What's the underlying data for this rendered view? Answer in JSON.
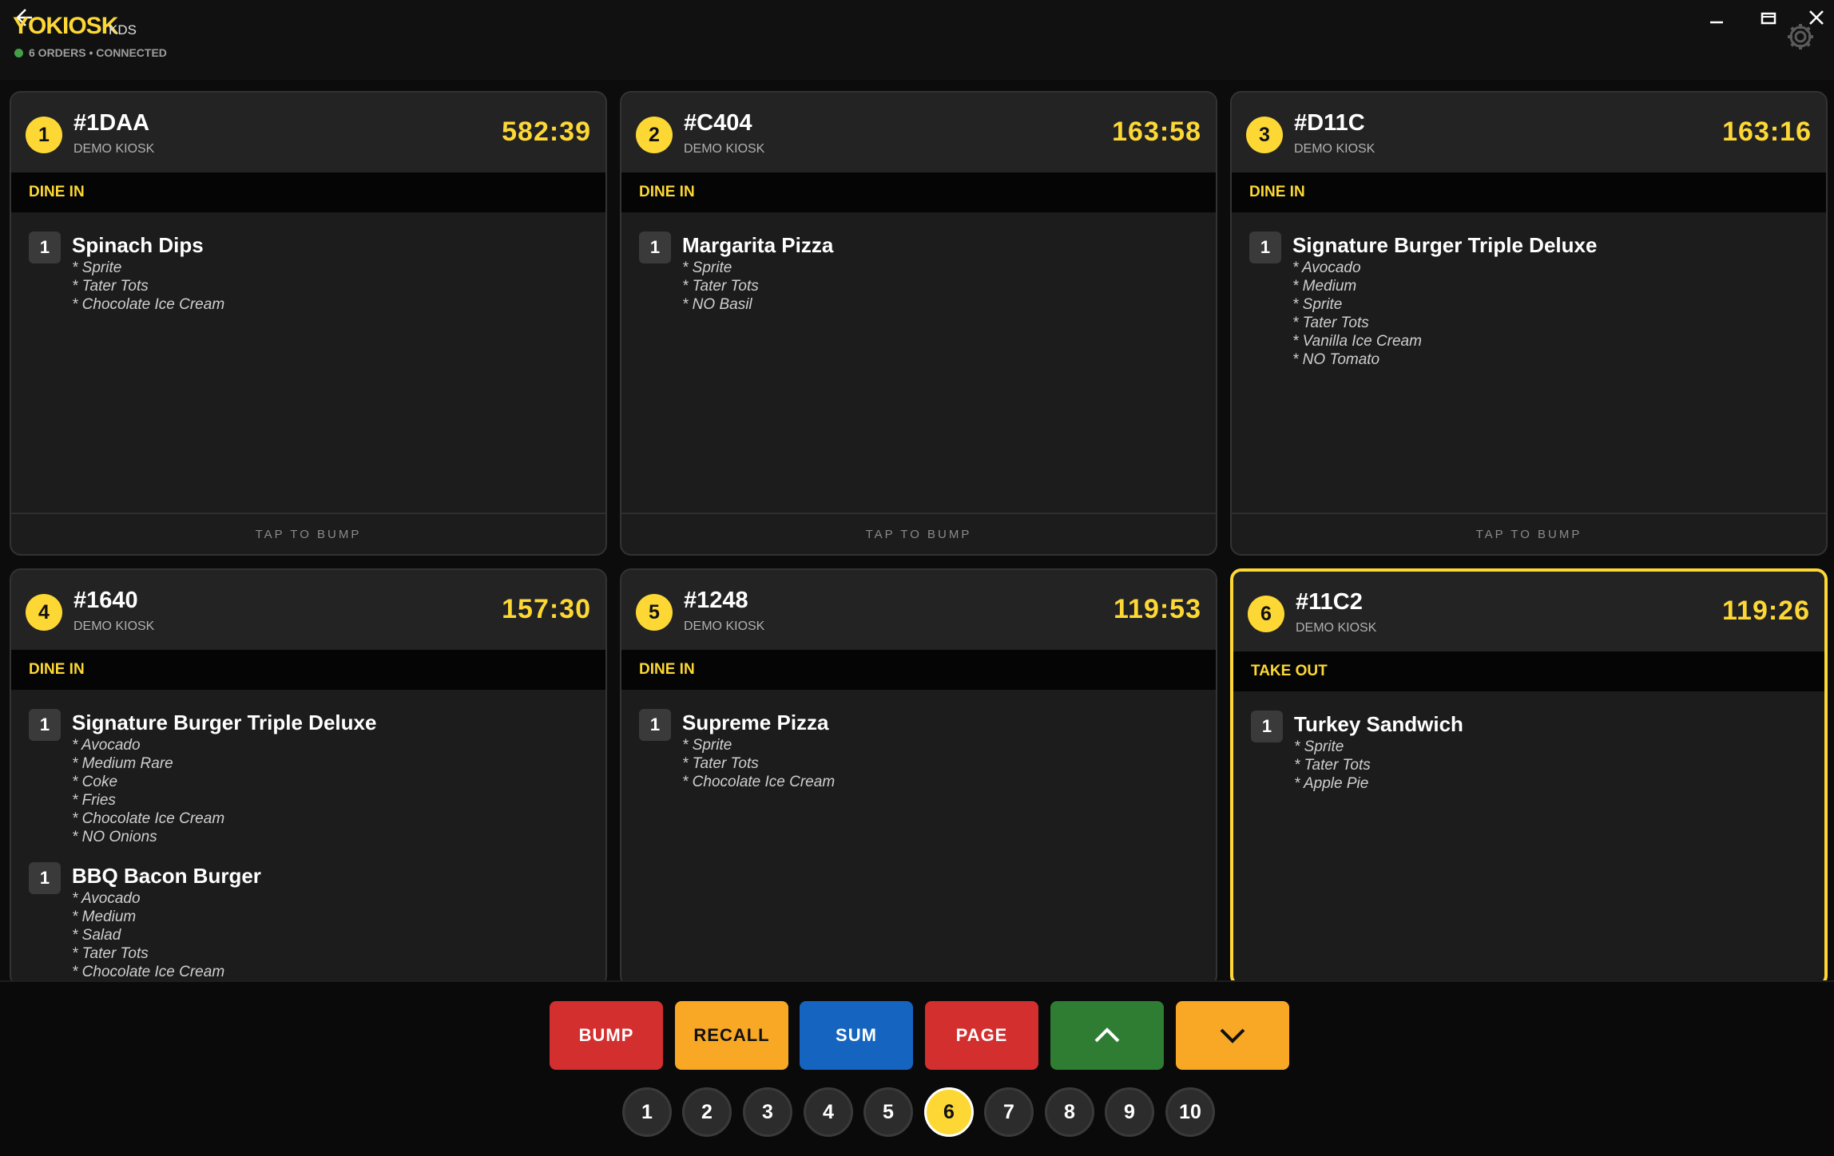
{
  "app": {
    "logo": "YOKIOSK",
    "logo_sub": "KDS",
    "status": "6 ORDERS • CONNECTED"
  },
  "icons": {
    "back": "back-arrow-icon",
    "minimize": "minimize-icon",
    "maximize": "maximize-icon",
    "close": "close-icon",
    "settings": "gear-icon"
  },
  "orders": [
    {
      "number": "1",
      "id": "#1DAA",
      "source": "DEMO KIOSK",
      "timer": "582:39",
      "type": "DINE IN",
      "footer": "TAP TO BUMP",
      "items": [
        {
          "qty": "1",
          "name": "Spinach Dips",
          "mods": [
            "* Sprite",
            "* Tater Tots",
            "* Chocolate Ice Cream"
          ]
        }
      ]
    },
    {
      "number": "2",
      "id": "#C404",
      "source": "DEMO KIOSK",
      "timer": "163:58",
      "type": "DINE IN",
      "footer": "TAP TO BUMP",
      "items": [
        {
          "qty": "1",
          "name": "Margarita Pizza",
          "mods": [
            "* Sprite",
            "* Tater Tots",
            "* NO Basil"
          ]
        }
      ]
    },
    {
      "number": "3",
      "id": "#D11C",
      "source": "DEMO KIOSK",
      "timer": "163:16",
      "type": "DINE IN",
      "footer": "TAP TO BUMP",
      "items": [
        {
          "qty": "1",
          "name": "Signature Burger Triple Deluxe",
          "mods": [
            "* Avocado",
            "* Medium",
            "* Sprite",
            "* Tater Tots",
            "* Vanilla Ice Cream",
            "* NO Tomato"
          ]
        }
      ]
    },
    {
      "number": "4",
      "id": "#1640",
      "source": "DEMO KIOSK",
      "timer": "157:30",
      "type": "DINE IN",
      "items": [
        {
          "qty": "1",
          "name": "Signature Burger Triple Deluxe",
          "mods": [
            "* Avocado",
            "* Medium Rare",
            "* Coke",
            "* Fries",
            "* Chocolate Ice Cream",
            "* NO Onions"
          ]
        },
        {
          "qty": "1",
          "name": "BBQ Bacon Burger",
          "mods": [
            "* Avocado",
            "* Medium",
            "* Salad",
            "* Tater Tots",
            "* Chocolate Ice Cream"
          ]
        }
      ]
    },
    {
      "number": "5",
      "id": "#1248",
      "source": "DEMO KIOSK",
      "timer": "119:53",
      "type": "DINE IN",
      "items": [
        {
          "qty": "1",
          "name": "Supreme Pizza",
          "mods": [
            "* Sprite",
            "* Tater Tots",
            "* Chocolate Ice Cream"
          ]
        }
      ]
    },
    {
      "number": "6",
      "id": "#11C2",
      "source": "DEMO KIOSK",
      "timer": "119:26",
      "type": "TAKE OUT",
      "selected": true,
      "items": [
        {
          "qty": "1",
          "name": "Turkey Sandwich",
          "mods": [
            "* Sprite",
            "* Tater Tots",
            "* Apple Pie"
          ]
        }
      ]
    }
  ],
  "controls": {
    "bump": "BUMP",
    "recall": "RECALL",
    "sum": "SUM",
    "page": "PAGE",
    "up_icon": "chevron-up-icon",
    "down_icon": "chevron-down-icon"
  },
  "pager": {
    "pages": [
      "1",
      "2",
      "3",
      "4",
      "5",
      "6",
      "7",
      "8",
      "9",
      "10"
    ],
    "active": "6"
  }
}
